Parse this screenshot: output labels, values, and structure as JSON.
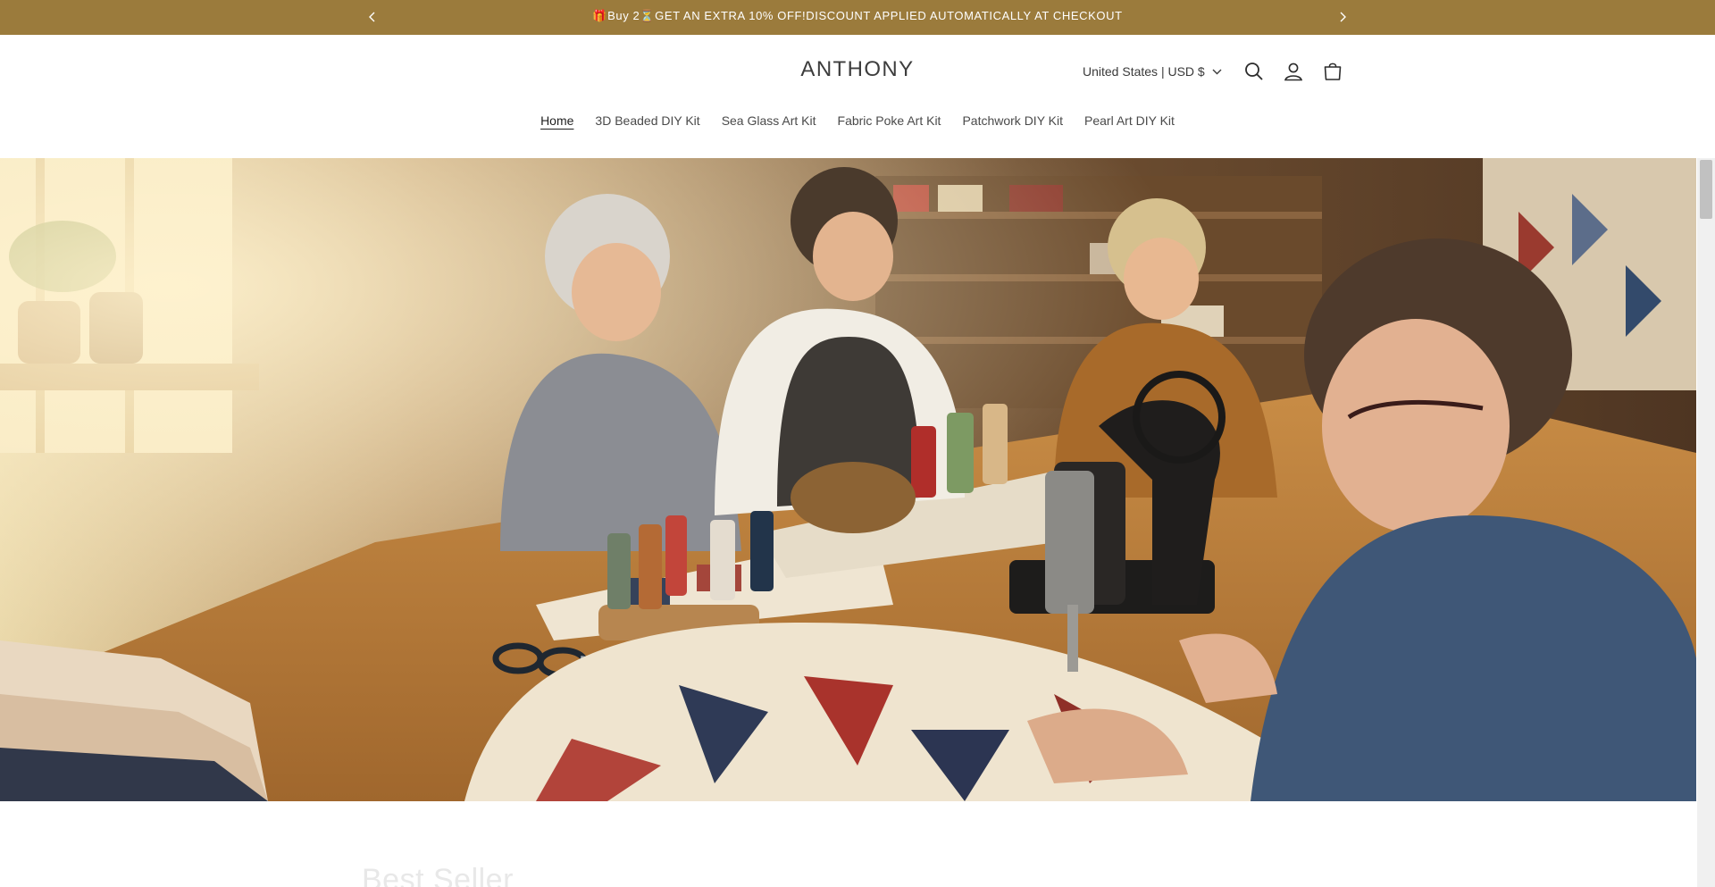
{
  "announcement": {
    "text": "🎁Buy 2⏳GET AN EXTRA 10% OFF!DISCOUNT APPLIED AUTOMATICALLY AT CHECKOUT",
    "prev_icon": "chevron-left-icon",
    "next_icon": "chevron-right-icon",
    "background": "#9b7b3c"
  },
  "header": {
    "logo": "ANTHONY",
    "country_selector": "United States | USD $",
    "icons": [
      "search-icon",
      "account-icon",
      "cart-icon"
    ]
  },
  "nav": {
    "items": [
      {
        "label": "Home",
        "active": true
      },
      {
        "label": "3D Beaded DIY Kit",
        "active": false
      },
      {
        "label": "Sea Glass Art Kit",
        "active": false
      },
      {
        "label": "Fabric Poke Art Kit",
        "active": false
      },
      {
        "label": "Patchwork DIY Kit",
        "active": false
      },
      {
        "label": "Pearl Art DIY Kit",
        "active": false
      }
    ]
  },
  "hero": {
    "image": "quilting-workshop-photo"
  },
  "section": {
    "title": "Best Seller"
  }
}
